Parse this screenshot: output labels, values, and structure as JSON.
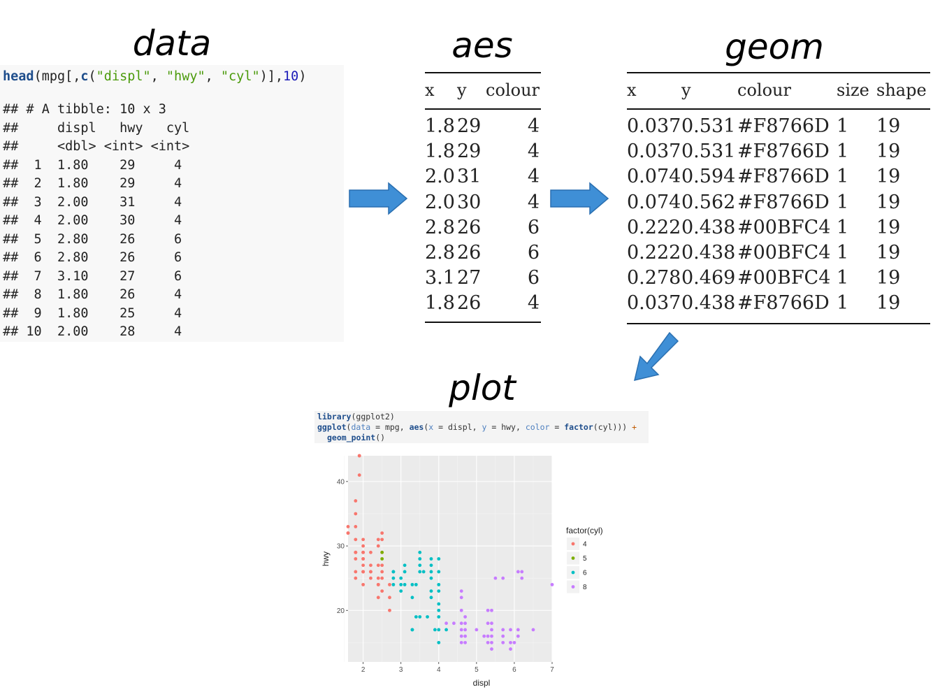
{
  "titles": {
    "data": "data",
    "aes": "aes",
    "geom": "geom",
    "plot": "plot"
  },
  "data_panel": {
    "code": {
      "fn1": "head",
      "p1": "(mpg[,",
      "fn2": "c",
      "p2": "(",
      "s1": "\"displ\"",
      "p3": ", ",
      "s2": "\"hwy\"",
      "p4": ", ",
      "s3": "\"cyl\"",
      "p5": ")],",
      "n1": "10",
      "p6": ")"
    },
    "output_lines": [
      "## # A tibble: 10 x 3",
      "##     displ   hwy   cyl",
      "##     <dbl> <int> <int>",
      "##  1  1.80    29     4",
      "##  2  1.80    29     4",
      "##  3  2.00    31     4",
      "##  4  2.00    30     4",
      "##  5  2.80    26     6",
      "##  6  2.80    26     6",
      "##  7  3.10    27     6",
      "##  8  1.80    26     4",
      "##  9  1.80    25     4",
      "## 10  2.00    28     4"
    ]
  },
  "aes_table": {
    "headers": [
      "x",
      "y",
      "colour"
    ],
    "rows": [
      [
        "1.8",
        "29",
        "4"
      ],
      [
        "1.8",
        "29",
        "4"
      ],
      [
        "2.0",
        "31",
        "4"
      ],
      [
        "2.0",
        "30",
        "4"
      ],
      [
        "2.8",
        "26",
        "6"
      ],
      [
        "2.8",
        "26",
        "6"
      ],
      [
        "3.1",
        "27",
        "6"
      ],
      [
        "1.8",
        "26",
        "4"
      ]
    ]
  },
  "geom_table": {
    "headers": [
      "x",
      "y",
      "colour",
      "size",
      "shape"
    ],
    "rows": [
      [
        "0.037",
        "0.531",
        "#F8766D",
        "1",
        "19"
      ],
      [
        "0.037",
        "0.531",
        "#F8766D",
        "1",
        "19"
      ],
      [
        "0.074",
        "0.594",
        "#F8766D",
        "1",
        "19"
      ],
      [
        "0.074",
        "0.562",
        "#F8766D",
        "1",
        "19"
      ],
      [
        "0.222",
        "0.438",
        "#00BFC4",
        "1",
        "19"
      ],
      [
        "0.222",
        "0.438",
        "#00BFC4",
        "1",
        "19"
      ],
      [
        "0.278",
        "0.469",
        "#00BFC4",
        "1",
        "19"
      ],
      [
        "0.037",
        "0.438",
        "#F8766D",
        "1",
        "19"
      ]
    ]
  },
  "snippet": {
    "line1_fn": "library",
    "line1_rest": "(ggplot2)",
    "line2_fn": "ggplot",
    "line2_a": "(",
    "line2_arg1": "data",
    "line2_b": " = mpg, ",
    "line2_fn2": "aes",
    "line2_c": "(",
    "line2_arg2": "x",
    "line2_d": " = displ, ",
    "line2_arg3": "y",
    "line2_e": " = hwy, ",
    "line2_arg4": "color",
    "line2_f": " = ",
    "line2_fn3": "factor",
    "line2_g": "(cyl))) ",
    "line2_op": "+",
    "line3_fn": "geom_point",
    "line3_rest": "()"
  },
  "colors": {
    "cyl4": "#F8766D",
    "cyl5": "#7CAE00",
    "cyl6": "#00BFC4",
    "cyl8": "#C77CFF",
    "arrow": "#3f8fd6",
    "panel_bg": "#EBEBEB"
  },
  "chart_data": {
    "type": "scatter",
    "xlabel": "displ",
    "ylabel": "hwy",
    "xlim": [
      1.6,
      7.0
    ],
    "ylim": [
      12,
      44
    ],
    "x_ticks": [
      2,
      3,
      4,
      5,
      6,
      7
    ],
    "y_ticks": [
      20,
      30,
      40
    ],
    "grid": true,
    "legend": {
      "title": "factor(cyl)",
      "placement": "right",
      "entries": [
        "4",
        "5",
        "6",
        "8"
      ]
    },
    "series": [
      {
        "name": "4",
        "points": [
          [
            1.8,
            29
          ],
          [
            1.8,
            29
          ],
          [
            2.0,
            31
          ],
          [
            2.0,
            30
          ],
          [
            1.8,
            26
          ],
          [
            1.8,
            25
          ],
          [
            2.0,
            28
          ],
          [
            2.0,
            28
          ],
          [
            1.8,
            29
          ],
          [
            2.0,
            29
          ],
          [
            2.0,
            26
          ],
          [
            1.6,
            33
          ],
          [
            1.6,
            32
          ],
          [
            1.6,
            32
          ],
          [
            1.8,
            35
          ],
          [
            1.8,
            37
          ],
          [
            1.8,
            33
          ],
          [
            1.9,
            44
          ],
          [
            1.9,
            41
          ],
          [
            1.9,
            44
          ],
          [
            2.0,
            29
          ],
          [
            2.0,
            26
          ],
          [
            2.0,
            29
          ],
          [
            2.2,
            26
          ],
          [
            2.2,
            27
          ],
          [
            2.2,
            29
          ],
          [
            2.4,
            30
          ],
          [
            2.4,
            31
          ],
          [
            2.4,
            25
          ],
          [
            2.4,
            24
          ],
          [
            2.5,
            26
          ],
          [
            2.5,
            25
          ],
          [
            2.5,
            23
          ],
          [
            2.5,
            27
          ],
          [
            2.5,
            32
          ],
          [
            2.5,
            31
          ],
          [
            2.5,
            29
          ],
          [
            2.0,
            24
          ],
          [
            2.4,
            27
          ],
          [
            2.4,
            22
          ],
          [
            2.2,
            26
          ],
          [
            2.2,
            25
          ],
          [
            1.8,
            31
          ],
          [
            1.8,
            28
          ],
          [
            2.0,
            27
          ],
          [
            2.0,
            26
          ],
          [
            2.4,
            24
          ],
          [
            2.7,
            20
          ],
          [
            2.7,
            22
          ],
          [
            2.7,
            24
          ]
        ]
      },
      {
        "name": "5",
        "points": [
          [
            2.5,
            29
          ],
          [
            2.5,
            28
          ]
        ]
      },
      {
        "name": "6",
        "points": [
          [
            2.8,
            26
          ],
          [
            2.8,
            26
          ],
          [
            3.1,
            27
          ],
          [
            2.8,
            24
          ],
          [
            2.8,
            25
          ],
          [
            3.0,
            24
          ],
          [
            3.0,
            25
          ],
          [
            3.3,
            24
          ],
          [
            3.3,
            22
          ],
          [
            3.3,
            17
          ],
          [
            3.3,
            17
          ],
          [
            3.5,
            29
          ],
          [
            3.5,
            28
          ],
          [
            3.5,
            27
          ],
          [
            3.5,
            26
          ],
          [
            3.5,
            19
          ],
          [
            3.6,
            26
          ],
          [
            3.7,
            19
          ],
          [
            3.8,
            28
          ],
          [
            3.8,
            27
          ],
          [
            3.8,
            26
          ],
          [
            3.8,
            25
          ],
          [
            3.8,
            23
          ],
          [
            3.8,
            22
          ],
          [
            3.9,
            17
          ],
          [
            4.0,
            28
          ],
          [
            4.0,
            26
          ],
          [
            4.0,
            24
          ],
          [
            4.0,
            23
          ],
          [
            4.0,
            21
          ],
          [
            4.0,
            20
          ],
          [
            4.0,
            19
          ],
          [
            4.0,
            17
          ],
          [
            4.0,
            15
          ],
          [
            3.4,
            24
          ],
          [
            3.1,
            26
          ],
          [
            3.0,
            23
          ],
          [
            4.2,
            17
          ],
          [
            3.1,
            24
          ],
          [
            3.4,
            19
          ]
        ]
      },
      {
        "name": "8",
        "points": [
          [
            4.2,
            18
          ],
          [
            4.4,
            18
          ],
          [
            4.6,
            23
          ],
          [
            4.6,
            22
          ],
          [
            4.6,
            20
          ],
          [
            4.6,
            18
          ],
          [
            4.6,
            17
          ],
          [
            4.6,
            16
          ],
          [
            4.6,
            15
          ],
          [
            4.7,
            17
          ],
          [
            4.7,
            16
          ],
          [
            4.7,
            15
          ],
          [
            4.7,
            18
          ],
          [
            4.7,
            19
          ],
          [
            5.0,
            17
          ],
          [
            5.2,
            16
          ],
          [
            5.3,
            20
          ],
          [
            5.3,
            18
          ],
          [
            5.3,
            16
          ],
          [
            5.3,
            15
          ],
          [
            5.4,
            20
          ],
          [
            5.4,
            18
          ],
          [
            5.4,
            17
          ],
          [
            5.4,
            16
          ],
          [
            5.4,
            15
          ],
          [
            5.4,
            14
          ],
          [
            5.7,
            17
          ],
          [
            5.7,
            16
          ],
          [
            5.7,
            15
          ],
          [
            5.9,
            15
          ],
          [
            5.9,
            17
          ],
          [
            6.0,
            15
          ],
          [
            6.1,
            16
          ],
          [
            6.2,
            26
          ],
          [
            6.2,
            25
          ],
          [
            6.5,
            17
          ],
          [
            7.0,
            24
          ],
          [
            5.7,
            25
          ],
          [
            6.1,
            26
          ],
          [
            5.9,
            14
          ],
          [
            6.1,
            17
          ],
          [
            5.5,
            25
          ]
        ]
      }
    ]
  }
}
